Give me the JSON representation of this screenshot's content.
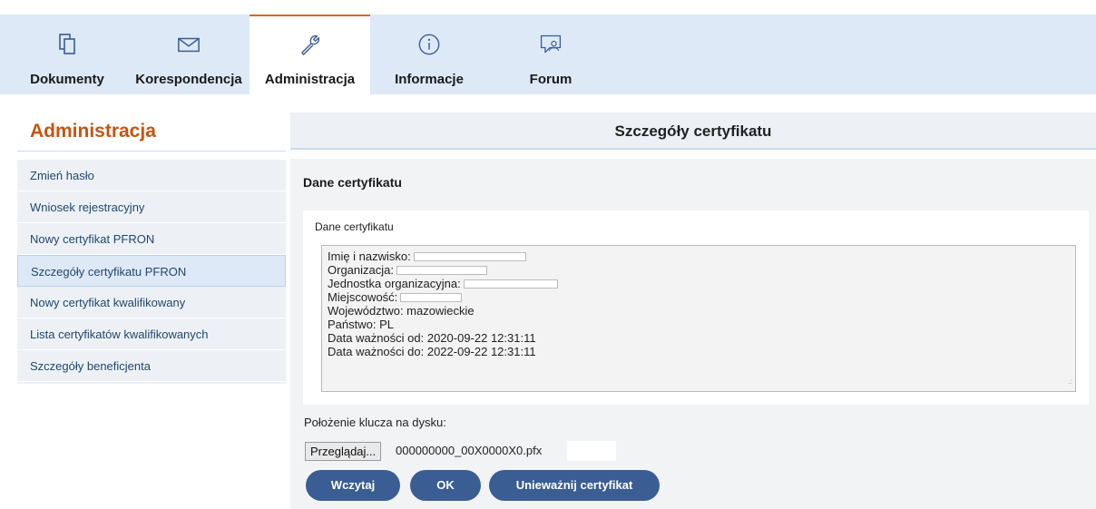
{
  "nav": {
    "tabs": [
      {
        "label": "Dokumenty",
        "icon": "documents-icon"
      },
      {
        "label": "Korespondencja",
        "icon": "envelope-icon"
      },
      {
        "label": "Administracja",
        "icon": "wrench-icon",
        "active": true
      },
      {
        "label": "Informacje",
        "icon": "info-icon"
      },
      {
        "label": "Forum",
        "icon": "forum-icon"
      }
    ]
  },
  "sidebar": {
    "title": "Administracja",
    "items": [
      {
        "label": "Zmień hasło"
      },
      {
        "label": "Wniosek rejestracyjny"
      },
      {
        "label": "Nowy certyfikat PFRON"
      },
      {
        "label": "Szczegóły certyfikatu PFRON",
        "active": true
      },
      {
        "label": "Nowy certyfikat kwalifikowany"
      },
      {
        "label": "Lista certyfikatów kwalifikowanych"
      },
      {
        "label": "Szczegóły beneficjenta"
      }
    ]
  },
  "main": {
    "title": "Szczegóły certyfikatu",
    "section_title": "Dane certyfikatu",
    "cert": {
      "label": "Dane certyfikatu",
      "name_label": "Imię i nazwisko:",
      "org_label": "Organizacja:",
      "unit_label": "Jednostka organizacyjna:",
      "city_label": "Miejscowość:",
      "voivodeship_line": "Województwo: mazowieckie",
      "country_line": "Państwo: PL",
      "valid_from_line": "Data ważności od: 2020-09-22 12:31:11",
      "valid_to_line": "Data ważności do: 2022-09-22 12:31:11"
    },
    "key_label": "Położenie klucza na dysku:",
    "browse_label": "Przeglądaj...",
    "file_name": "000000000_00X0000X0.pfx",
    "buttons": {
      "load": "Wczytaj",
      "ok": "OK",
      "revoke": "Unieważnij certyfikat"
    }
  },
  "colors": {
    "nav_bg": "#dde9f7",
    "accent_orange": "#c8530f",
    "button_blue": "#3a5d93",
    "sidebar_bg": "#edf1f5"
  }
}
